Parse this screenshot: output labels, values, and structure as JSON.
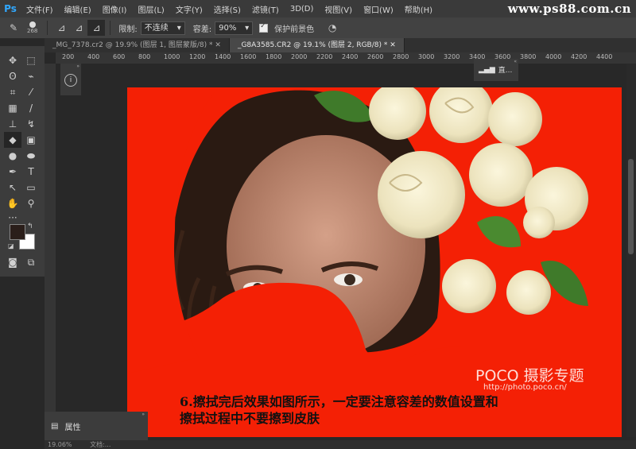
{
  "app": {
    "logo": "Ps",
    "site_watermark": "www.ps88.com.cn"
  },
  "menu": [
    "文件(F)",
    "编辑(E)",
    "图像(I)",
    "图层(L)",
    "文字(Y)",
    "选择(S)",
    "滤镜(T)",
    "3D(D)",
    "视图(V)",
    "窗口(W)",
    "帮助(H)"
  ],
  "options": {
    "brush_size": "268",
    "limit_label": "限制:",
    "limit_value": "不连续",
    "tolerance_label": "容差:",
    "tolerance_value": "90%",
    "protect_fg_label": "保护前景色",
    "protect_fg_checked": true
  },
  "tabs": [
    {
      "label": "_MG_7378.cr2 @ 19.9% (图层 1, 图层蒙版/8) *",
      "active": false
    },
    {
      "label": "_G8A3585.CR2 @ 19.1% (图层 2, RGB/8) *",
      "active": true
    }
  ],
  "ruler_ticks": [
    "200",
    "400",
    "600",
    "800",
    "1000",
    "1200",
    "1400",
    "1600",
    "1800",
    "2000",
    "2200",
    "2400",
    "2600",
    "2800",
    "3000",
    "3200",
    "3400",
    "3600",
    "3800",
    "4000",
    "4200",
    "4400"
  ],
  "panels": {
    "properties_label": "属性",
    "histogram_label": "直..."
  },
  "canvas": {
    "background_color": "#f42005",
    "caption_line1": "6.擦拭完后效果如图所示，一定要注意容差的数值设置和",
    "caption_line2": "擦拭过程中不要擦到皮肤",
    "poco_logo": "POCO 摄影专题",
    "poco_url": "http://photo.poco.cn/"
  },
  "status": {
    "zoom": "19.06%",
    "doc": "文档:..."
  },
  "colors": {
    "foreground": "#2a1e1a",
    "background": "#ffffff"
  }
}
